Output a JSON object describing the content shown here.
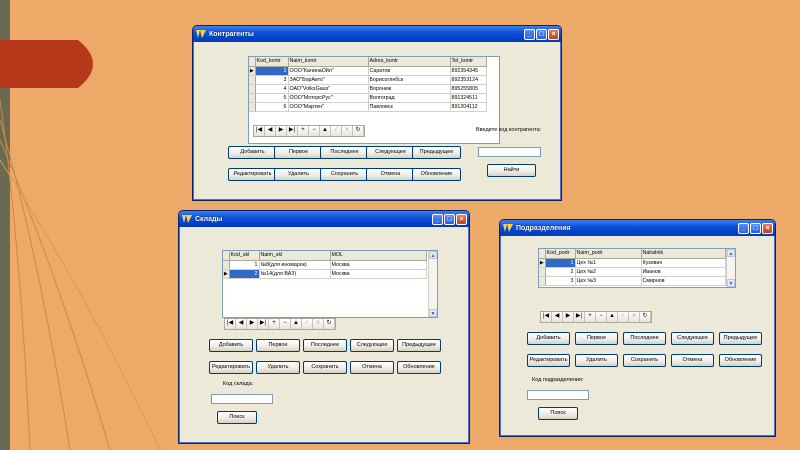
{
  "windows": {
    "kontragenty": {
      "title": "Контрагенты",
      "columns": [
        "Kod_kontr",
        "Naim_kontr",
        "Adres_kontr",
        "Tel_kontr"
      ],
      "rows": [
        {
          "indicator": "▶",
          "cells": [
            "2",
            "ООО\"КалинаОйл\"",
            "Саратов",
            "892354345"
          ]
        },
        {
          "indicator": "",
          "cells": [
            "3",
            "ЗАО\"БорАвто\"",
            "Борисоглебск",
            "892353124"
          ]
        },
        {
          "indicator": "",
          "cells": [
            "4",
            "ОАО\"VolksGaus\"",
            "Воронеж",
            "895255805"
          ]
        },
        {
          "indicator": "",
          "cells": [
            "5",
            "ООО\"МоторсРус\"",
            "Волгоград",
            "891324511"
          ]
        },
        {
          "indicator": "",
          "cells": [
            "6",
            "ООО\"Мартен\"",
            "Павловск",
            "891204112"
          ]
        }
      ],
      "buttons_row1": [
        "Добавить",
        "Первое",
        "Последнее",
        "Следующее",
        "Предыдущее"
      ],
      "buttons_row2": [
        "Редактировать",
        "Удалить",
        "Сохранить",
        "Отмена",
        "Обновление"
      ],
      "search_label": "Введите код контрагента:",
      "search_value": "",
      "search_button": "Найти"
    },
    "sklady": {
      "title": "Склады",
      "columns": [
        "Kod_skl",
        "Naim_skl",
        "MOL"
      ],
      "rows": [
        {
          "indicator": "",
          "cells": [
            "1",
            "№8(для иномарок)",
            "Москва"
          ]
        },
        {
          "indicator": "▶",
          "cells": [
            "2",
            "№14(для ВАЗ)",
            "Москва"
          ]
        }
      ],
      "buttons_row1": [
        "Добавить",
        "Первое",
        "Последнее",
        "Следующее",
        "Предыдущее"
      ],
      "buttons_row2": [
        "Редактировать",
        "Удалить",
        "Сохранить",
        "Отмена",
        "Обновление"
      ],
      "search_label": "Код склада:",
      "search_value": "",
      "search_button": "Поиск"
    },
    "podrazdeleniya": {
      "title": "Подразделения",
      "columns": [
        "Kod_podr",
        "Naim_podr",
        "Nahalnik"
      ],
      "rows": [
        {
          "indicator": "▶",
          "cells": [
            "1",
            "Цех №1",
            "Кузовин"
          ]
        },
        {
          "indicator": "",
          "cells": [
            "2",
            "Цех №2",
            "Иванов"
          ]
        },
        {
          "indicator": "",
          "cells": [
            "3",
            "Цех №3",
            "Смирнов"
          ]
        }
      ],
      "buttons_row1": [
        "Добавить",
        "Первое",
        "Последнее",
        "Следующее",
        "Предыдущее"
      ],
      "buttons_row2": [
        "Редактировать",
        "Удалить",
        "Сохранить",
        "Отмена",
        "Обновление"
      ],
      "search_label": "Код подразделения:",
      "search_value": "",
      "search_button": "Поиск"
    }
  },
  "navigator": {
    "buttons": [
      {
        "glyph": "|◀",
        "name": "nav-first-button",
        "enabled": true
      },
      {
        "glyph": "◀",
        "name": "nav-prior-button",
        "enabled": true
      },
      {
        "glyph": "▶",
        "name": "nav-next-button",
        "enabled": true
      },
      {
        "glyph": "▶|",
        "name": "nav-last-button",
        "enabled": true
      },
      {
        "glyph": "+",
        "name": "nav-insert-button",
        "enabled": true
      },
      {
        "glyph": "−",
        "name": "nav-delete-button",
        "enabled": true
      },
      {
        "glyph": "▲",
        "name": "nav-edit-button",
        "enabled": true
      },
      {
        "glyph": "✓",
        "name": "nav-post-button",
        "enabled": false
      },
      {
        "glyph": "✕",
        "name": "nav-cancel-button",
        "enabled": false
      },
      {
        "glyph": "↻",
        "name": "nav-refresh-button",
        "enabled": true
      }
    ]
  },
  "colors": {
    "background": "#eda968",
    "leaf": "#b5391a",
    "titlebar": "#0a4fd6",
    "selection": "#316ac5"
  }
}
